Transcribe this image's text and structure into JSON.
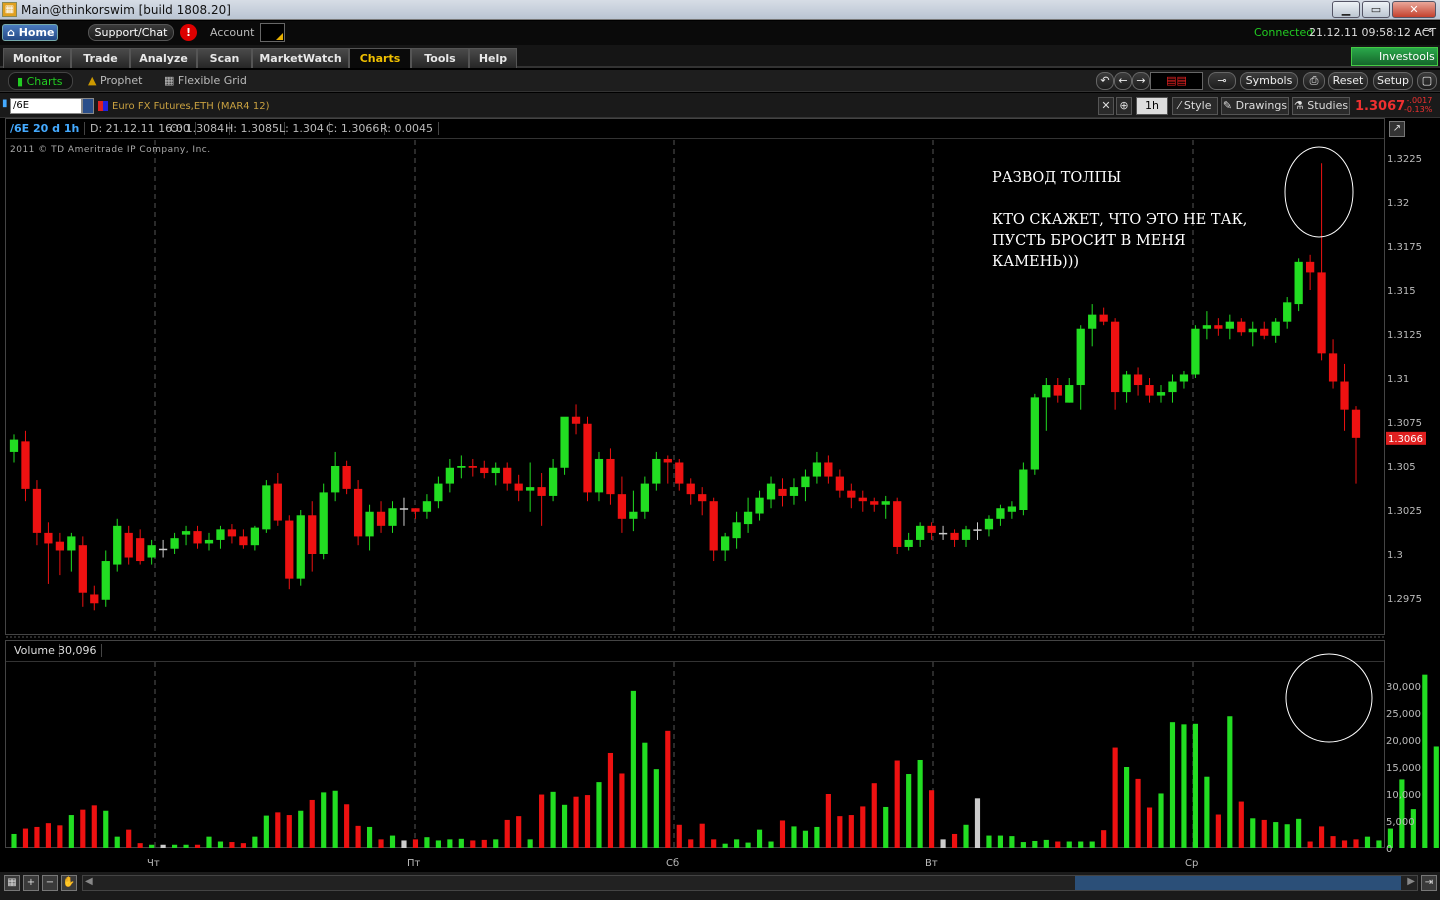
{
  "window": {
    "title": "Main@thinkorswim [build 1808.20]",
    "min": "▁",
    "max": "▭",
    "close": "✕"
  },
  "top": {
    "home": "Home",
    "support": "Support/Chat",
    "alert": "!",
    "account_label": "Account",
    "connection": "Connected",
    "datetime": "21.12.11 09:58:12 ACT"
  },
  "nav": {
    "tabs": [
      "Monitor",
      "Trade",
      "Analyze",
      "Scan",
      "MarketWatch",
      "Charts",
      "Tools",
      "Help"
    ],
    "active": "Charts",
    "investools": "Investools"
  },
  "subnav": {
    "charts": "Charts",
    "prophet": "Prophet",
    "flexible_grid": "Flexible Grid",
    "symbols": "Symbols",
    "reset": "Reset",
    "setup": "Setup"
  },
  "chartbar": {
    "symbol": "/6E",
    "description": "Euro FX Futures,ETH (MAR4 12)",
    "timeframe": "1h",
    "style": "Style",
    "drawings": "Drawings",
    "studies": "Studies",
    "last_price": "1.3067",
    "change_abs": "-.0017",
    "change_pct": "-0.13%"
  },
  "info": {
    "symbol_period": "/6E 20 d 1h",
    "date": "D: 21.12.11 16:00",
    "open": "O: 1.3084",
    "high": "H: 1.3085",
    "low": "L: 1.304",
    "close": "C: 1.3066",
    "range": "R: 0.0045",
    "copyright": "2011 © TD Ameritrade IP Company, Inc."
  },
  "annotation": {
    "line1": "РАЗВОД ТОЛПЫ",
    "line2": "КТО СКАЖЕТ, ЧТО ЭТО НЕ ТАК, ПУСТЬ БРОСИТ В МЕНЯ КАМЕНЬ)))"
  },
  "volume_panel": {
    "label": "Volume",
    "value": "30,096"
  },
  "colors": {
    "up": "#22dd22",
    "down": "#ee1111",
    "neutral": "#cccccc",
    "grid": "#555555",
    "price_tag": "#e02020"
  },
  "chart_data": [
    {
      "type": "candlestick",
      "title": "/6E 20 d 1h",
      "y_ticks": [
        "1.3225",
        "1.32",
        "1.3175",
        "1.315",
        "1.3125",
        "1.31",
        "1.3075",
        "1.305",
        "1.3025",
        "1.3",
        "1.2975"
      ],
      "ylim": [
        1.2958,
        1.3238
      ],
      "last_price_label": "1.3066",
      "x_day_labels": [
        "Чт",
        "Пт",
        "Сб",
        "Вт",
        "Ср"
      ],
      "candles_ohlc": [
        [
          1.3058,
          1.3068,
          1.3052,
          1.3065
        ],
        [
          1.3064,
          1.307,
          1.303,
          1.3037
        ],
        [
          1.3037,
          1.3042,
          1.3005,
          1.3012
        ],
        [
          1.3012,
          1.3018,
          1.2983,
          1.3006
        ],
        [
          1.3007,
          1.3012,
          1.2988,
          1.3002
        ],
        [
          1.3002,
          1.3012,
          1.299,
          1.301
        ],
        [
          1.3005,
          1.301,
          1.297,
          1.2978
        ],
        [
          1.2977,
          1.2982,
          1.2968,
          1.2972
        ],
        [
          1.2974,
          1.3002,
          1.297,
          1.2996
        ],
        [
          1.2994,
          1.302,
          1.299,
          1.3016
        ],
        [
          1.3012,
          1.3016,
          1.2994,
          1.2998
        ],
        [
          1.3009,
          1.3014,
          1.2994,
          1.2996
        ],
        [
          1.2998,
          1.3008,
          1.2994,
          1.3005
        ],
        [
          1.3003,
          1.3008,
          1.2998,
          1.3003
        ],
        [
          1.3003,
          1.3012,
          1.3,
          1.3009
        ],
        [
          1.3011,
          1.3016,
          1.3005,
          1.3013
        ],
        [
          1.3013,
          1.3016,
          1.3003,
          1.3006
        ],
        [
          1.3006,
          1.3012,
          1.3002,
          1.3008
        ],
        [
          1.3008,
          1.3016,
          1.3003,
          1.3014
        ],
        [
          1.3014,
          1.3017,
          1.3006,
          1.301
        ],
        [
          1.301,
          1.3014,
          1.3003,
          1.3005
        ],
        [
          1.3005,
          1.3016,
          1.3002,
          1.3015
        ],
        [
          1.3014,
          1.3042,
          1.3012,
          1.3039
        ],
        [
          1.304,
          1.3046,
          1.3016,
          1.3019
        ],
        [
          1.3019,
          1.3022,
          1.298,
          1.2986
        ],
        [
          1.2986,
          1.3025,
          1.2982,
          1.3022
        ],
        [
          1.3022,
          1.303,
          1.299,
          1.3
        ],
        [
          1.3,
          1.304,
          1.2997,
          1.3035
        ],
        [
          1.3035,
          1.3058,
          1.303,
          1.305
        ],
        [
          1.305,
          1.3053,
          1.3034,
          1.3037
        ],
        [
          1.3037,
          1.3042,
          1.3005,
          1.301
        ],
        [
          1.301,
          1.3028,
          1.3002,
          1.3024
        ],
        [
          1.3024,
          1.303,
          1.3012,
          1.3016
        ],
        [
          1.3016,
          1.303,
          1.3012,
          1.3026
        ],
        [
          1.3026,
          1.3032,
          1.3016,
          1.3026
        ],
        [
          1.3026,
          1.3026,
          1.302,
          1.3024
        ],
        [
          1.3024,
          1.3034,
          1.302,
          1.303
        ],
        [
          1.303,
          1.3044,
          1.3026,
          1.304
        ],
        [
          1.304,
          1.3054,
          1.3035,
          1.3049
        ],
        [
          1.3049,
          1.3056,
          1.3043,
          1.305
        ],
        [
          1.305,
          1.3054,
          1.3044,
          1.3049
        ],
        [
          1.3049,
          1.3053,
          1.3043,
          1.3046
        ],
        [
          1.3046,
          1.3052,
          1.3039,
          1.3049
        ],
        [
          1.3049,
          1.3052,
          1.3036,
          1.304
        ],
        [
          1.304,
          1.3045,
          1.303,
          1.3036
        ],
        [
          1.3036,
          1.3052,
          1.3024,
          1.3038
        ],
        [
          1.3038,
          1.3046,
          1.3016,
          1.3033
        ],
        [
          1.3033,
          1.3054,
          1.303,
          1.3049
        ],
        [
          1.3049,
          1.3073,
          1.3045,
          1.3078
        ],
        [
          1.3078,
          1.3085,
          1.3068,
          1.3074
        ],
        [
          1.3074,
          1.3078,
          1.303,
          1.3035
        ],
        [
          1.3035,
          1.3058,
          1.303,
          1.3054
        ],
        [
          1.3054,
          1.306,
          1.3028,
          1.3034
        ],
        [
          1.3034,
          1.3044,
          1.3012,
          1.302
        ],
        [
          1.302,
          1.3036,
          1.3013,
          1.3024
        ],
        [
          1.3024,
          1.3044,
          1.302,
          1.304
        ],
        [
          1.304,
          1.3058,
          1.3036,
          1.3054
        ],
        [
          1.3054,
          1.3056,
          1.304,
          1.3052
        ],
        [
          1.3052,
          1.3054,
          1.3036,
          1.304
        ],
        [
          1.304,
          1.3043,
          1.3028,
          1.3034
        ],
        [
          1.3034,
          1.3038,
          1.3022,
          1.303
        ],
        [
          1.303,
          1.3032,
          1.2996,
          1.3002
        ],
        [
          1.3002,
          1.3012,
          1.2996,
          1.301
        ],
        [
          1.3009,
          1.3024,
          1.3003,
          1.3018
        ],
        [
          1.3017,
          1.3032,
          1.3012,
          1.3024
        ],
        [
          1.3023,
          1.3036,
          1.3019,
          1.3032
        ],
        [
          1.3031,
          1.3044,
          1.3026,
          1.304
        ],
        [
          1.3037,
          1.3043,
          1.3027,
          1.3033
        ],
        [
          1.3033,
          1.3043,
          1.3028,
          1.3038
        ],
        [
          1.3038,
          1.3048,
          1.303,
          1.3044
        ],
        [
          1.3044,
          1.3058,
          1.304,
          1.3052
        ],
        [
          1.3052,
          1.3056,
          1.304,
          1.3044
        ],
        [
          1.3044,
          1.3048,
          1.3032,
          1.3036
        ],
        [
          1.3036,
          1.304,
          1.3026,
          1.3032
        ],
        [
          1.3032,
          1.3036,
          1.3024,
          1.303
        ],
        [
          1.303,
          1.3032,
          1.3024,
          1.3028
        ],
        [
          1.3028,
          1.3033,
          1.302,
          1.303
        ],
        [
          1.303,
          1.3032,
          1.3,
          1.3004
        ],
        [
          1.3004,
          1.3012,
          1.3002,
          1.3008
        ],
        [
          1.3008,
          1.3018,
          1.3004,
          1.3016
        ],
        [
          1.3016,
          1.3018,
          1.3008,
          1.3012
        ],
        [
          1.3012,
          1.3016,
          1.3008,
          1.3012
        ],
        [
          1.3012,
          1.3014,
          1.3004,
          1.3008
        ],
        [
          1.3008,
          1.3016,
          1.3004,
          1.3014
        ],
        [
          1.3014,
          1.3018,
          1.3008,
          1.3014
        ],
        [
          1.3014,
          1.3022,
          1.301,
          1.302
        ],
        [
          1.302,
          1.3028,
          1.3016,
          1.3026
        ],
        [
          1.3024,
          1.303,
          1.302,
          1.3027
        ],
        [
          1.3025,
          1.3052,
          1.3022,
          1.3048
        ],
        [
          1.3048,
          1.3091,
          1.3045,
          1.3089
        ],
        [
          1.3089,
          1.31,
          1.307,
          1.3096
        ],
        [
          1.3096,
          1.31,
          1.3086,
          1.309
        ],
        [
          1.3086,
          1.31,
          1.3086,
          1.3096
        ],
        [
          1.3096,
          1.313,
          1.3082,
          1.3128
        ],
        [
          1.3128,
          1.3142,
          1.3118,
          1.3136
        ],
        [
          1.3136,
          1.314,
          1.313,
          1.3132
        ],
        [
          1.3132,
          1.3134,
          1.3082,
          1.3092
        ],
        [
          1.3092,
          1.3104,
          1.3086,
          1.3102
        ],
        [
          1.3102,
          1.3106,
          1.309,
          1.3096
        ],
        [
          1.3096,
          1.31,
          1.3086,
          1.309
        ],
        [
          1.309,
          1.3096,
          1.3086,
          1.3092
        ],
        [
          1.3092,
          1.3102,
          1.3086,
          1.3098
        ],
        [
          1.3098,
          1.3104,
          1.3094,
          1.3102
        ],
        [
          1.3102,
          1.313,
          1.31,
          1.3128
        ],
        [
          1.3128,
          1.3138,
          1.3122,
          1.313
        ],
        [
          1.313,
          1.3134,
          1.3124,
          1.3128
        ],
        [
          1.3128,
          1.3136,
          1.3122,
          1.3132
        ],
        [
          1.3132,
          1.3134,
          1.3124,
          1.3126
        ],
        [
          1.3126,
          1.3132,
          1.3118,
          1.3128
        ],
        [
          1.3128,
          1.3132,
          1.3122,
          1.3124
        ],
        [
          1.3124,
          1.3134,
          1.312,
          1.3132
        ],
        [
          1.3132,
          1.3146,
          1.3128,
          1.3143
        ],
        [
          1.3142,
          1.3168,
          1.3138,
          1.3166
        ],
        [
          1.3166,
          1.317,
          1.315,
          1.316
        ],
        [
          1.316,
          1.3222,
          1.311,
          1.3114
        ],
        [
          1.3114,
          1.3122,
          1.3094,
          1.3098
        ],
        [
          1.3098,
          1.3108,
          1.307,
          1.3082
        ],
        [
          1.3082,
          1.3084,
          1.304,
          1.3066
        ]
      ]
    },
    {
      "type": "bar",
      "title": "Volume",
      "y_ticks": [
        "30,000",
        "25,000",
        "20,000",
        "15,000",
        "10,000",
        "5,000",
        "0"
      ],
      "ylim": [
        0,
        33000
      ],
      "values": [
        2600,
        3600,
        3900,
        4600,
        4200,
        6100,
        7100,
        7900,
        6900,
        2100,
        3400,
        900,
        600,
        600,
        600,
        600,
        600,
        2100,
        1200,
        1100,
        900,
        2100,
        6000,
        6600,
        6100,
        6900,
        8900,
        10300,
        10600,
        8100,
        4100,
        3900,
        1600,
        2300,
        1400,
        1600,
        2000,
        1400,
        1600,
        1700,
        1400,
        1500,
        1600,
        5200,
        5900,
        1600,
        9900,
        10400,
        8000,
        9500,
        9800,
        12200,
        17600,
        13800,
        29100,
        19500,
        14600,
        21700,
        4300,
        1600,
        4500,
        1600,
        800,
        1600,
        1000,
        3400,
        1200,
        5100,
        4000,
        3200,
        3900,
        10000,
        5900,
        6100,
        7700,
        12000,
        7600,
        16200,
        13700,
        16300,
        10700,
        1600,
        2600,
        4300,
        9200,
        2300,
        2300,
        2200,
        1100,
        1300,
        1500,
        1200,
        1200,
        1200,
        1200,
        3300,
        18600,
        15000,
        12800,
        7500,
        10100,
        23300,
        22900,
        23000,
        13200,
        6200,
        24400,
        8600,
        5500,
        5200,
        4800,
        4400,
        5400,
        1200,
        4000,
        2200,
        1400,
        1600,
        2100,
        1400,
        3600,
        12700,
        7200,
        32100,
        18800,
        13100,
        29900
      ]
    }
  ]
}
